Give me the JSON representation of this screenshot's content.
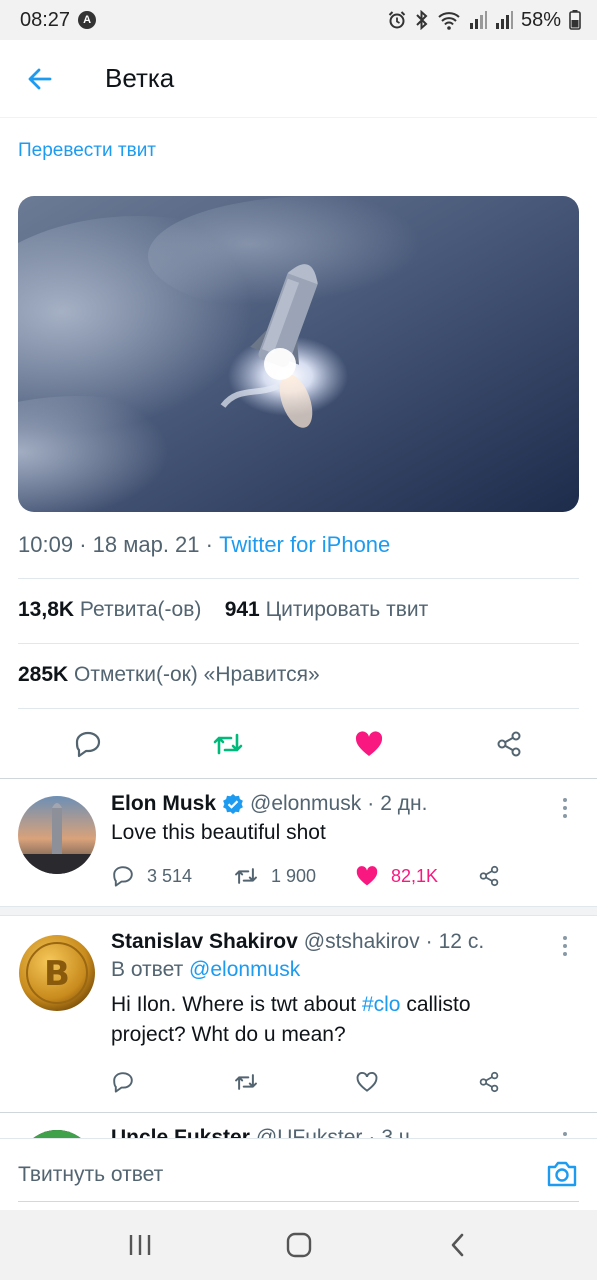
{
  "status_bar": {
    "time": "08:27",
    "alert_badge": "A",
    "battery": "58%"
  },
  "header": {
    "title": "Ветка"
  },
  "tweet": {
    "translate": "Перевести твит",
    "time": "10:09",
    "date": "18 мар. 21",
    "source": "Twitter for iPhone",
    "retweets_count": "13,8K",
    "retweets_label": "Ретвита(-ов)",
    "quotes_count": "941",
    "quotes_label": "Цитировать твит",
    "likes_count": "285K",
    "likes_label": "Отметки(-ок) «Нравится»"
  },
  "replies": [
    {
      "name": "Elon Musk",
      "handle": "@elonmusk",
      "age": "2 дн.",
      "text": "Love this beautiful shot",
      "replies": "3 514",
      "retweets": "1 900",
      "likes": "82,1K"
    },
    {
      "name": "Stanislav Shakirov",
      "handle": "@stshakirov",
      "age": "12 с.",
      "reply_to_label": "В ответ",
      "reply_to_handle": "@elonmusk",
      "text_part1": "Hi Ilon. Where is twt about",
      "hashtag": "#clo",
      "text_part2": "callisto",
      "text_line2": "project? Wht do u mean?"
    },
    {
      "name": "Uncle Fukster",
      "handle": "@UFukster",
      "age": "3 ч."
    }
  ],
  "compose": {
    "placeholder": "Твитнуть ответ"
  },
  "colors": {
    "accent": "#1d9bf0",
    "like": "#f91880",
    "retweet": "#00ba7c",
    "text": "#0f1419",
    "muted": "#536471"
  }
}
